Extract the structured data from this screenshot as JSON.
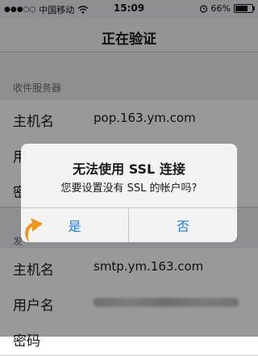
{
  "status_bar": {
    "carrier": "中国移动",
    "time": "15:09",
    "battery": "66%",
    "battery_level": 0.66
  },
  "nav": {
    "title": "正在验证"
  },
  "incoming_section": {
    "header": "收件服务器",
    "rows": [
      {
        "label": "主机名",
        "value": "pop.163.ym.com"
      },
      {
        "label": "用",
        "value": ""
      },
      {
        "label": "密",
        "value": ""
      }
    ]
  },
  "outgoing_section": {
    "header": "发",
    "rows": [
      {
        "label": "主机名",
        "value": "smtp.ym.163.com"
      },
      {
        "label": "用户名",
        "value": ""
      },
      {
        "label": "密码",
        "value": ""
      }
    ]
  },
  "alert": {
    "title": "无法使用 SSL 连接",
    "message": "您要设置没有 SSL 的帐户吗?",
    "yes_label": "是",
    "no_label": "否"
  },
  "colors": {
    "accent": "#1a7bf5",
    "pointer_arrow": "#f0961e"
  }
}
